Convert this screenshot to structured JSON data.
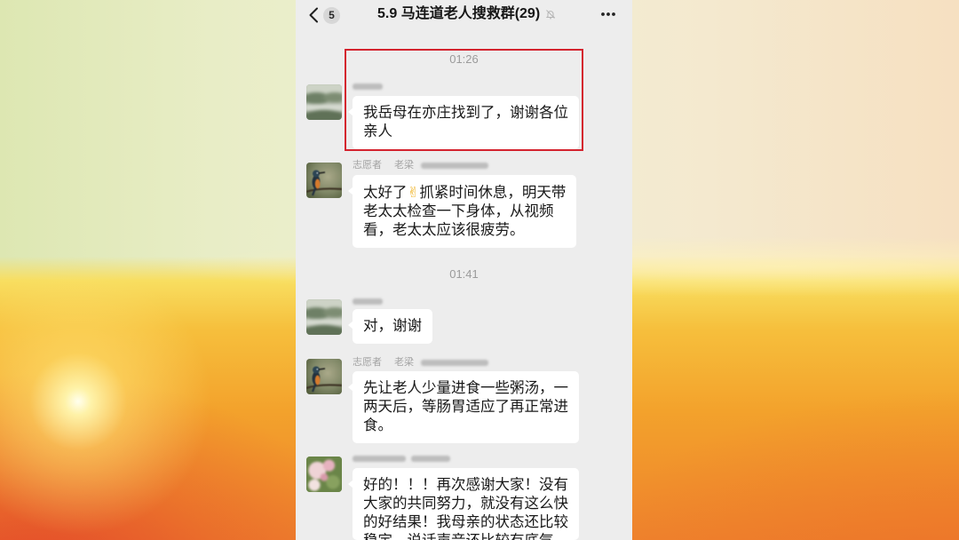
{
  "chat": {
    "header": {
      "back_icon": "chevron-left-icon",
      "unread_badge": "5",
      "title": "5.9 马连道老人搜救群(29)",
      "mute_icon": "bell-mute-icon",
      "more_icon": "ellipsis-icon"
    },
    "timestamps": [
      "01:26",
      "01:41"
    ],
    "messages": [
      {
        "avatar_icon": "landscape-photo-avatar",
        "lines": [
          "我岳母在亦庄找到了，谢谢各位",
          "亲人"
        ]
      },
      {
        "avatar_icon": "bird-photo-avatar",
        "sender_role": "志愿者",
        "sender_name": "老梁",
        "lines": [
          "太好了✌抓紧时间休息，明天带",
          "老太太检查一下身体，从视频",
          "看，老太太应该很疲劳。"
        ]
      },
      {
        "avatar_icon": "landscape-photo-avatar",
        "lines": [
          "对，谢谢"
        ]
      },
      {
        "avatar_icon": "bird-photo-avatar",
        "sender_role": "志愿者",
        "sender_name": "老梁",
        "lines": [
          "先让老人少量进食一些粥汤，一",
          "两天后，等肠胃适应了再正常进",
          "食。"
        ]
      },
      {
        "avatar_icon": "flower-photo-avatar",
        "lines": [
          "好的！！！再次感谢大家！没有",
          "大家的共同努力，就没有这么快",
          "的好结果！我母亲的状态还比较",
          "稳定，说话声音还比较有底气"
        ]
      }
    ]
  },
  "colors": {
    "chat_background": "#ededed",
    "bubble": "#ffffff",
    "highlight_border": "#d4232e",
    "emoji": "#f0b429"
  }
}
